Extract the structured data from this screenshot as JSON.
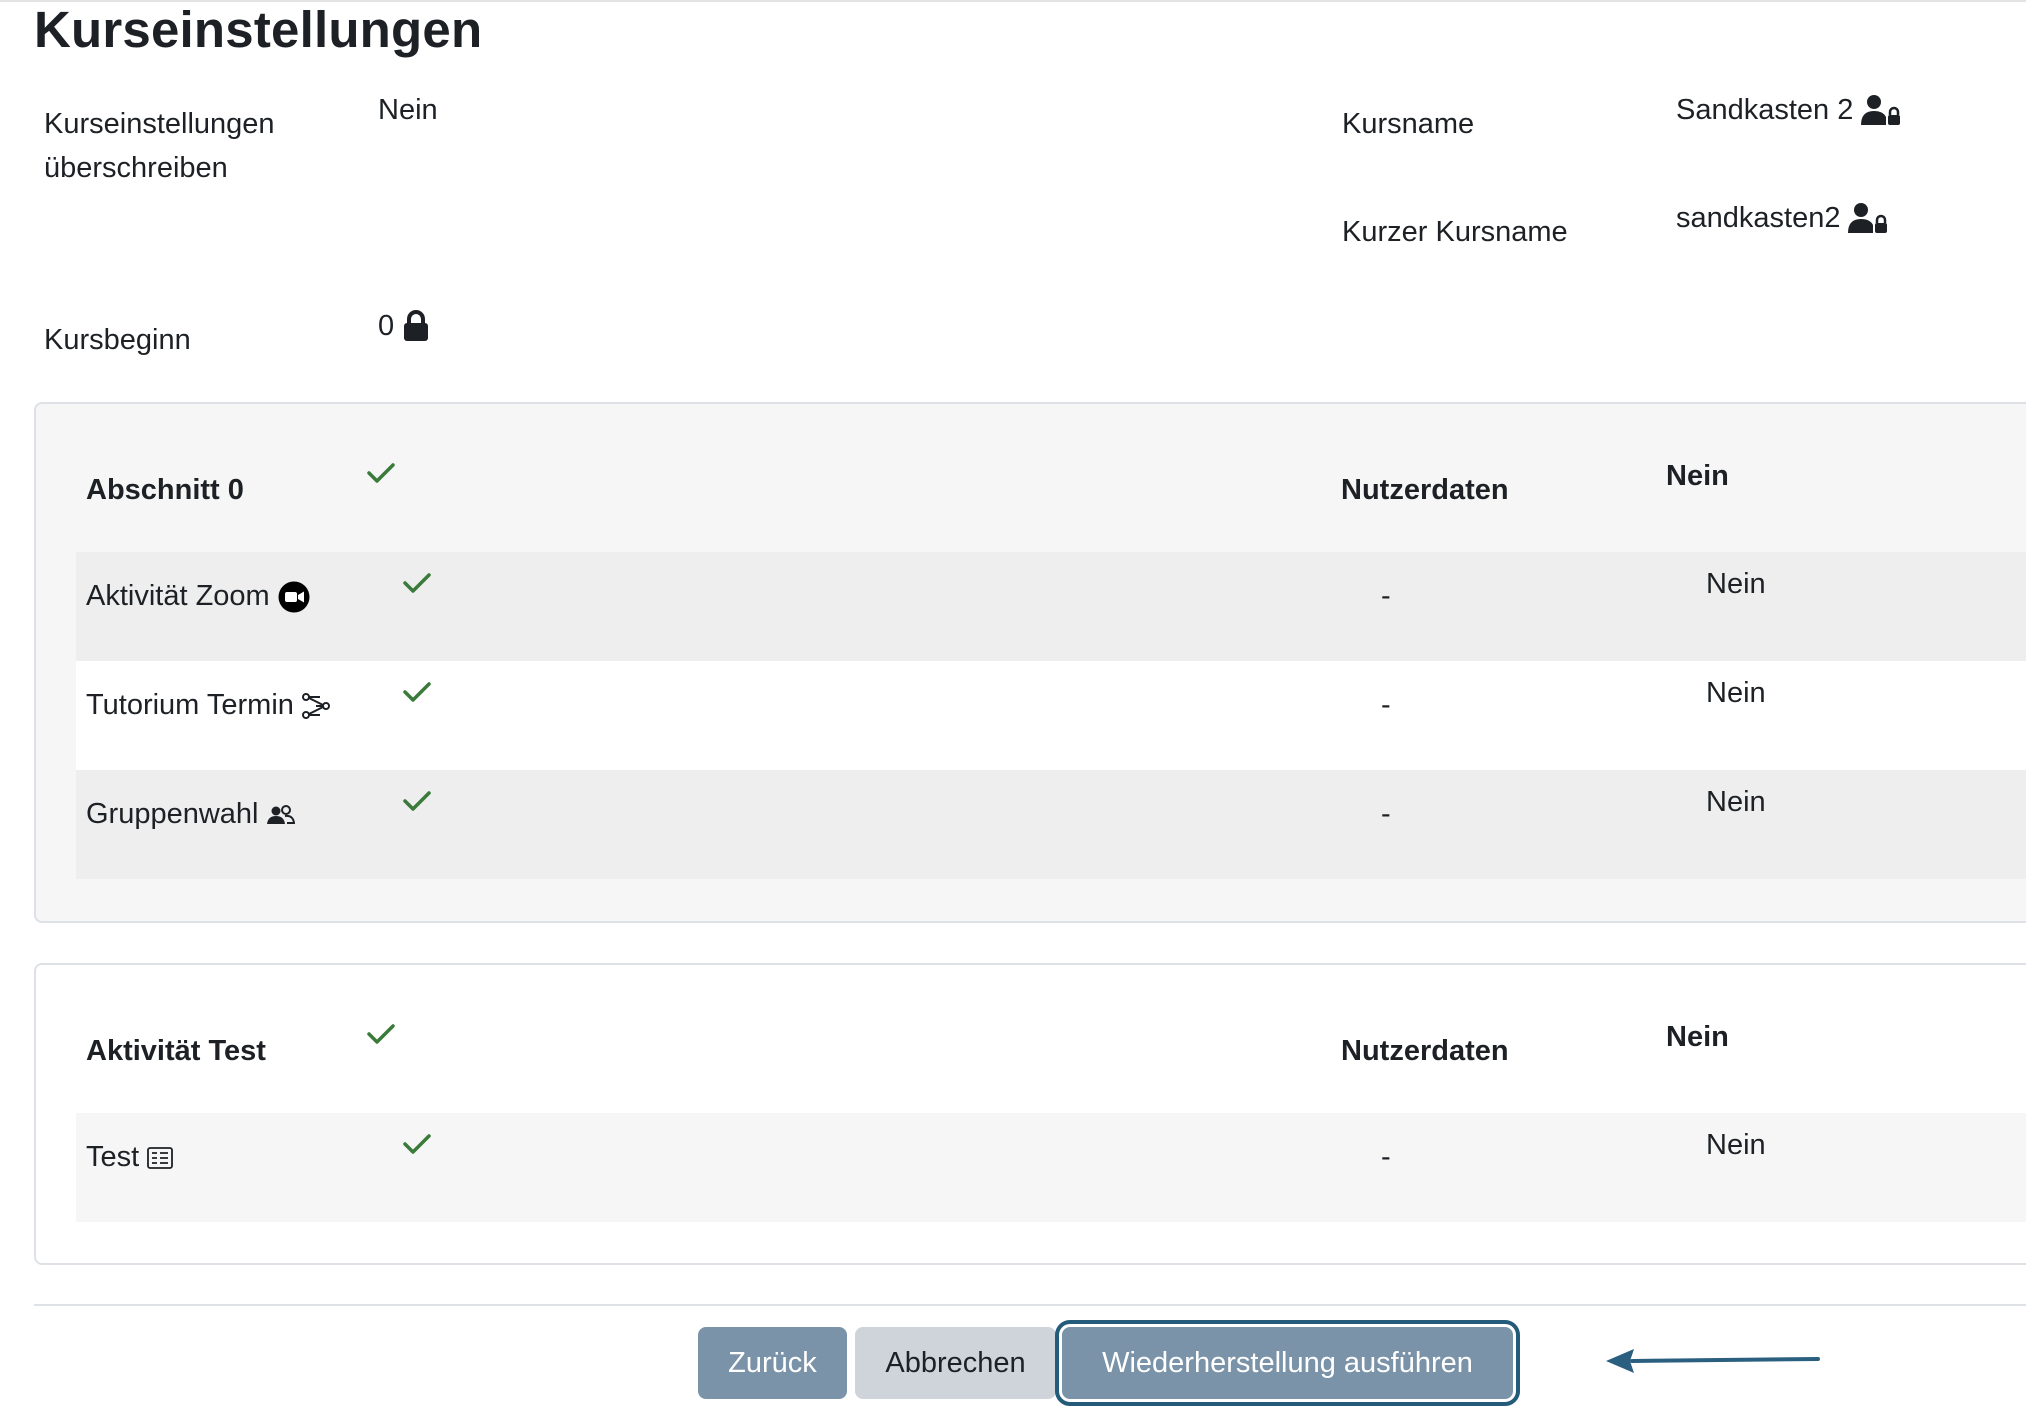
{
  "page": {
    "title": "Kurseinstellungen"
  },
  "settings": {
    "overwrite_label_line1": "Kurseinstellungen",
    "overwrite_label_line2": "überschreiben",
    "overwrite_value": "Nein",
    "course_start_label": "Kursbeginn",
    "course_start_value": "0",
    "course_name_label": "Kursname",
    "course_name_value": "Sandkasten 2",
    "short_name_label": "Kurzer Kursname",
    "short_name_value": "sandkasten2"
  },
  "sections": [
    {
      "header": {
        "name": "Abschnitt 0",
        "userdata_label": "Nutzerdaten",
        "value": "Nein"
      },
      "items": [
        {
          "name": "Aktivität Zoom",
          "icon": "zoom-icon",
          "userdata": "-",
          "value": "Nein"
        },
        {
          "name": "Tutorium Termin",
          "icon": "scheduler-icon",
          "userdata": "-",
          "value": "Nein"
        },
        {
          "name": "Gruppenwahl",
          "icon": "group-choice-icon",
          "userdata": "-",
          "value": "Nein"
        }
      ]
    },
    {
      "header": {
        "name": "Aktivität Test",
        "userdata_label": "Nutzerdaten",
        "value": "Nein"
      },
      "items": [
        {
          "name": "Test",
          "icon": "quiz-icon",
          "userdata": "-",
          "value": "Nein"
        }
      ]
    }
  ],
  "buttons": {
    "back": "Zurück",
    "cancel": "Abbrechen",
    "run_restore": "Wiederherstellung ausführen"
  },
  "colors": {
    "check": "#3a7a3a",
    "primary_button": "#7a93a8",
    "secondary_button": "#ced4da",
    "focus_outline": "#245a7a",
    "arrow": "#2a5f80"
  }
}
